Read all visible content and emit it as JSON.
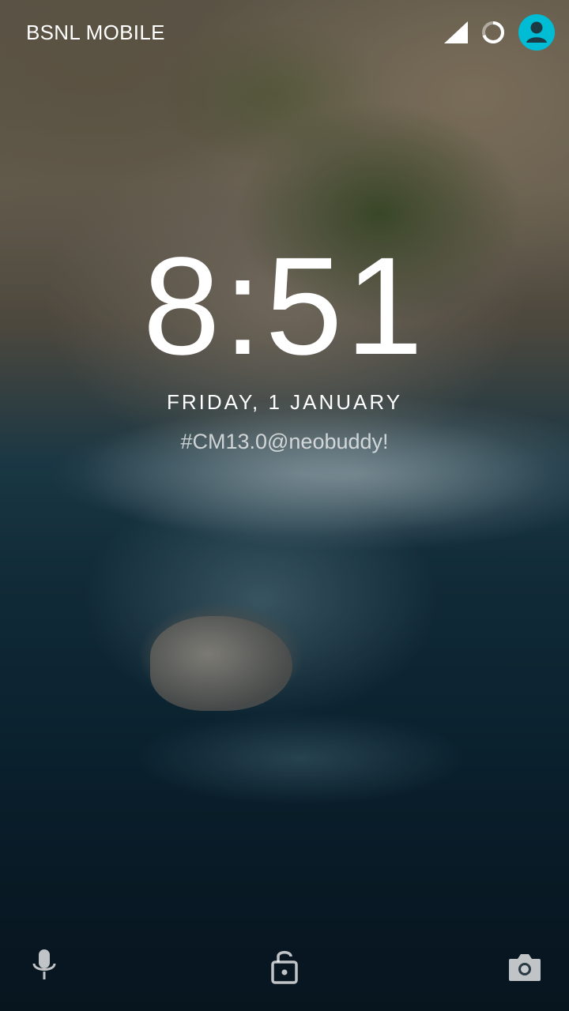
{
  "status_bar": {
    "carrier": "BSNL MOBILE",
    "icons": [
      "signal-icon",
      "sync-icon",
      "user-icon"
    ],
    "user_icon_color": "#00bcd4"
  },
  "lockscreen": {
    "clock": "8:51",
    "date": "FRIDAY, 1 JANUARY",
    "owner_info": "#CM13.0@neobuddy!"
  },
  "bottom_bar": {
    "left_icon": "mic-icon",
    "center_icon": "lock-icon",
    "right_icon": "camera-icon"
  }
}
